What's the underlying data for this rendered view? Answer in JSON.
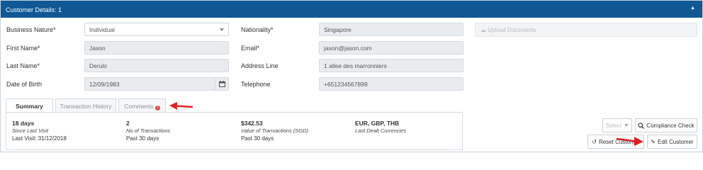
{
  "header": {
    "title": "Customer Details: 1",
    "collapse_icon": "chevron-up-icon"
  },
  "form": {
    "business_nature": {
      "label": "Business Nature*",
      "value": "Individual"
    },
    "first_name": {
      "label": "First Name*",
      "value": "Jason"
    },
    "last_name": {
      "label": "Last Name*",
      "value": "Derulo"
    },
    "date_of_birth": {
      "label": "Date of Birth",
      "value": "12/09/1983"
    },
    "nationality": {
      "label": "Nationality*",
      "value": "Singapore"
    },
    "email": {
      "label": "Email*",
      "value": "jason@jason.com"
    },
    "address": {
      "label": "Address Line",
      "value": "1 allee des marronniers"
    },
    "telephone": {
      "label": "Telephone",
      "value": "+651234567899"
    }
  },
  "upload": {
    "label": "Upload Documents",
    "icon": "cloud-upload-icon"
  },
  "tabs": [
    {
      "label": "Summary"
    },
    {
      "label": "Transaction History"
    },
    {
      "label": "Comments"
    }
  ],
  "summary": {
    "col1": {
      "value": "18 days",
      "sub": "Since Last Visit",
      "extra": "Last Visit: 31/12/2018"
    },
    "col2": {
      "value": "2",
      "sub": "No of Transactions",
      "extra": "Past 30 days"
    },
    "col3": {
      "value": "$342.53",
      "sub": "Value of Transactions (SGD)",
      "extra": "Past 30 days"
    },
    "col4": {
      "value": "EUR, GBP, THB",
      "sub": "Last Dealt Currencies"
    }
  },
  "actions": {
    "select": "Select",
    "compliance": "Compliance Check",
    "reset": "Reset Customer",
    "edit": "Edit Customer"
  },
  "colors": {
    "header": "#0f5895",
    "arrow": "#e02020",
    "alert": "#d9534f"
  }
}
